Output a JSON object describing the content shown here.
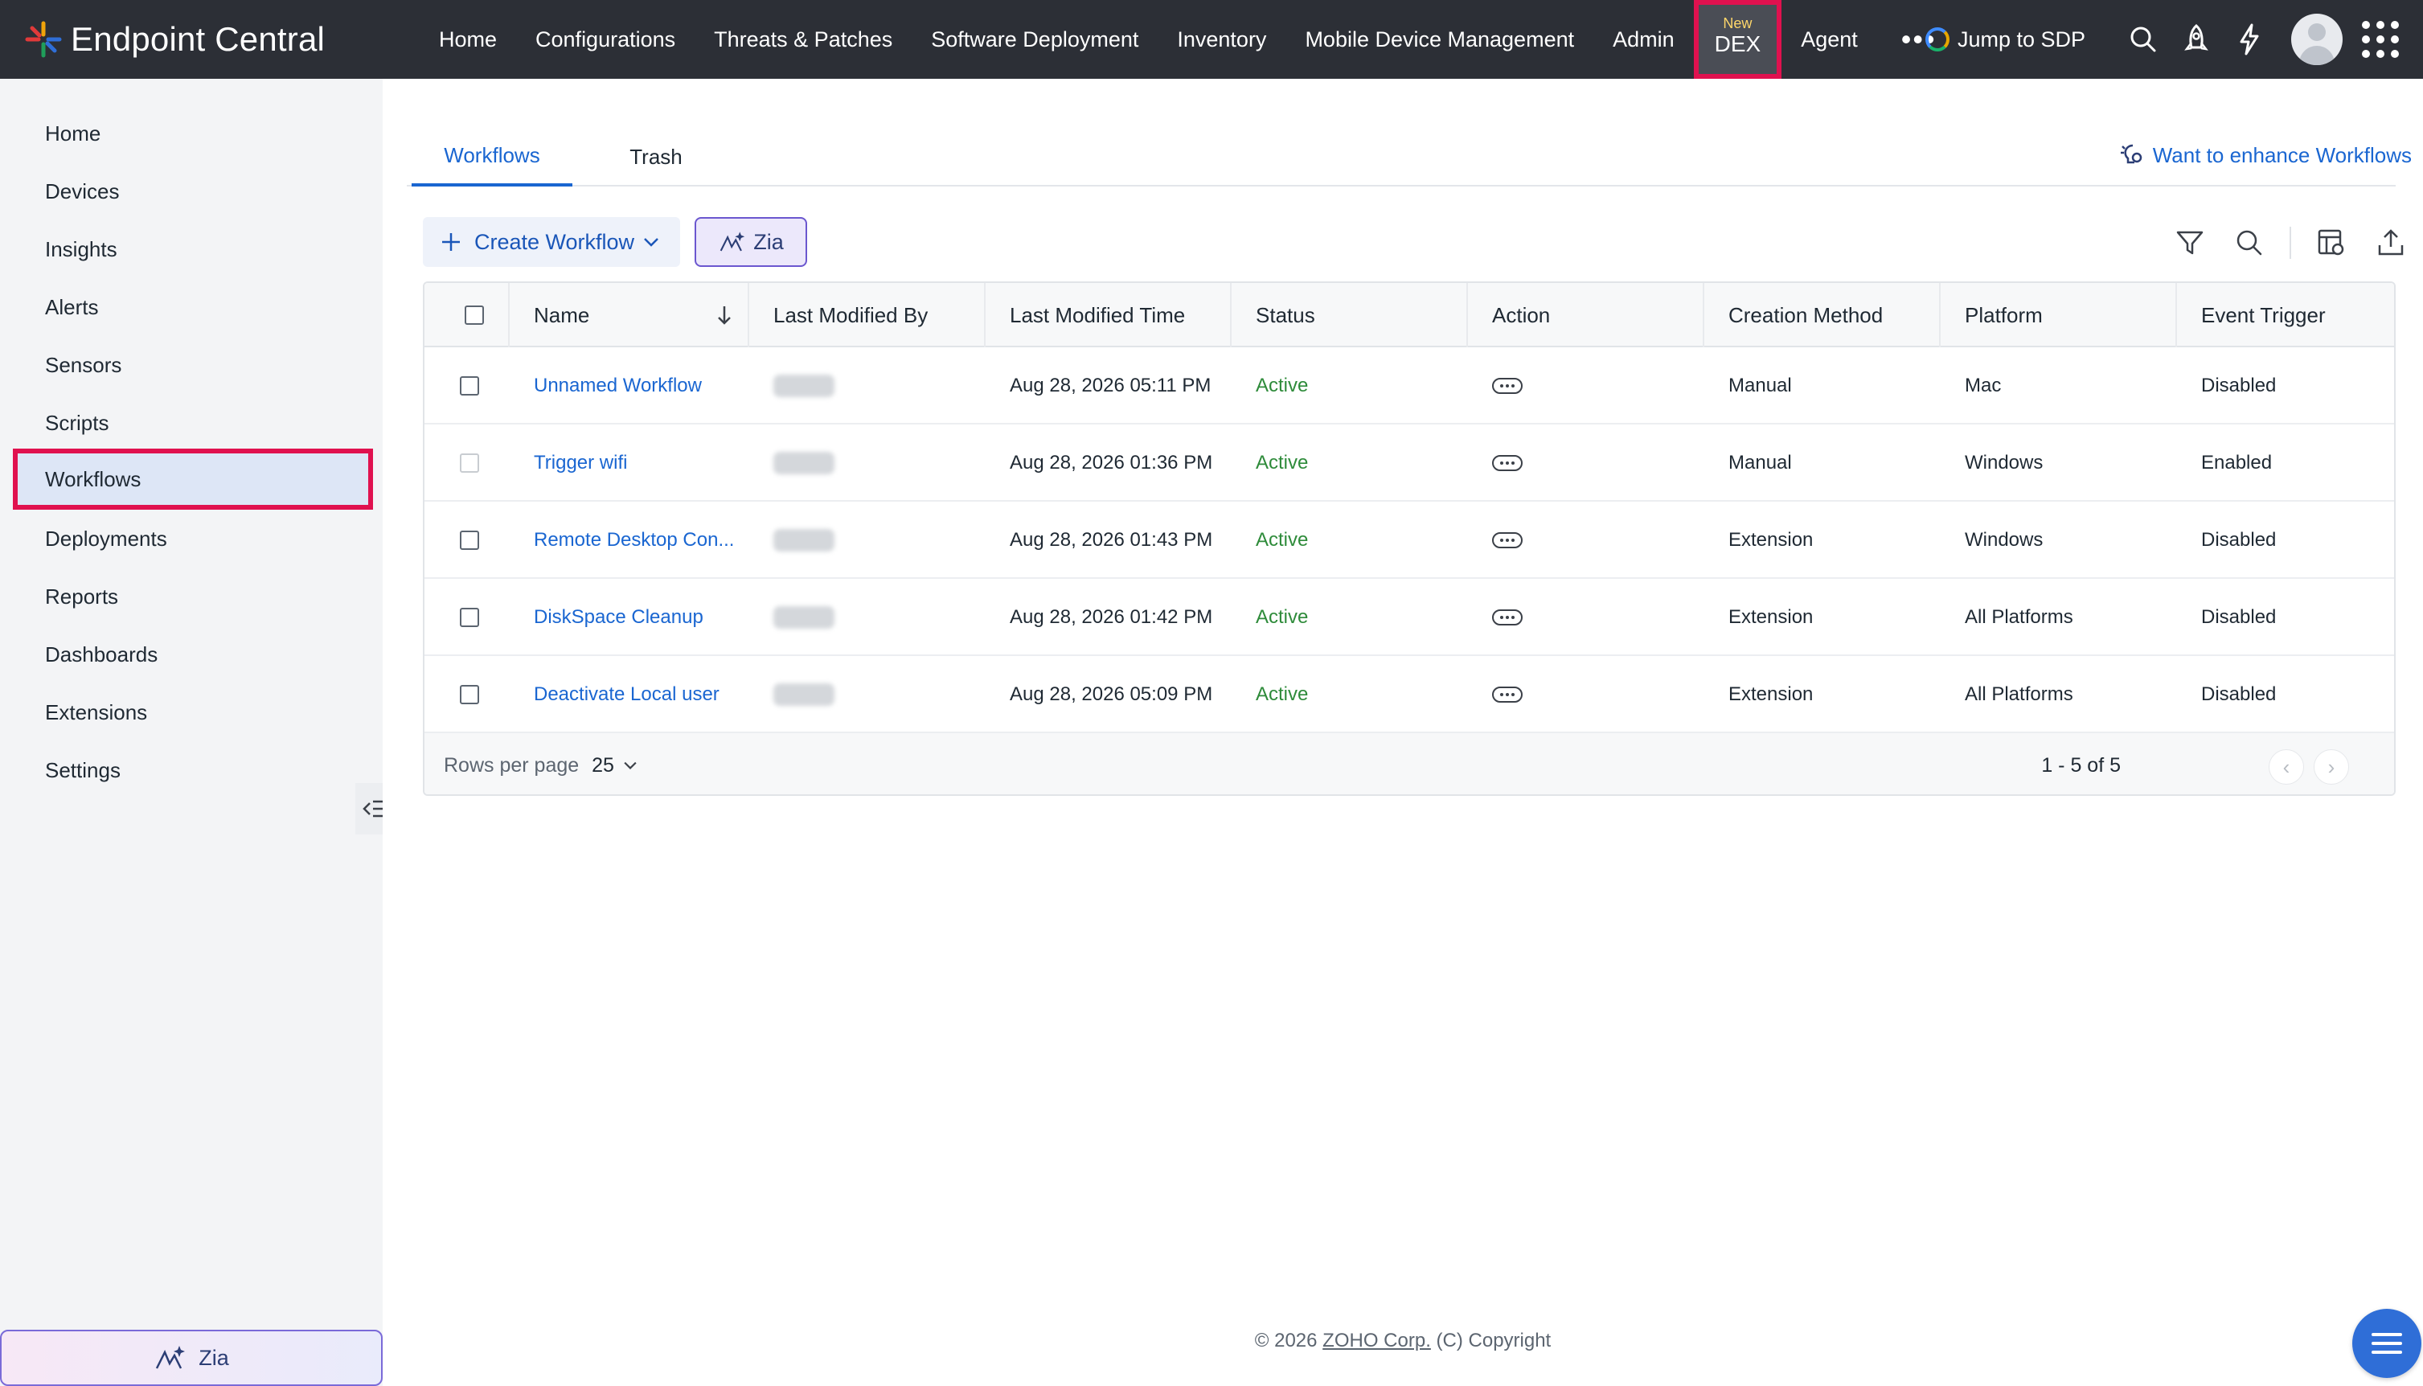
{
  "header": {
    "brand": "Endpoint Central",
    "nav": [
      {
        "label": "Home"
      },
      {
        "label": "Configurations"
      },
      {
        "label": "Threats & Patches"
      },
      {
        "label": "Software Deployment"
      },
      {
        "label": "Inventory"
      },
      {
        "label": "Mobile Device Management"
      },
      {
        "label": "Admin"
      },
      {
        "label": "DEX",
        "tag": "New"
      },
      {
        "label": "Agent"
      }
    ],
    "more": "•••",
    "jump_label": "Jump to SDP",
    "icons": [
      "search-icon",
      "rocket-icon",
      "lightning-icon",
      "avatar",
      "apps-grid-icon"
    ]
  },
  "sidebar": {
    "items": [
      {
        "label": "Home"
      },
      {
        "label": "Devices"
      },
      {
        "label": "Insights"
      },
      {
        "label": "Alerts"
      },
      {
        "label": "Sensors"
      },
      {
        "label": "Scripts"
      },
      {
        "label": "Workflows",
        "active": true
      },
      {
        "label": "Deployments"
      },
      {
        "label": "Reports"
      },
      {
        "label": "Dashboards"
      },
      {
        "label": "Extensions"
      },
      {
        "label": "Settings"
      }
    ],
    "zia_label": "Zia"
  },
  "main": {
    "tabs": [
      {
        "label": "Workflows",
        "active": true
      },
      {
        "label": "Trash"
      }
    ],
    "enhance_link": "Want to enhance Workflows",
    "create_label": "Create Workflow",
    "zia_label": "Zia",
    "table": {
      "columns": [
        "Name",
        "Last Modified By",
        "Last Modified Time",
        "Status",
        "Action",
        "Creation Method",
        "Platform",
        "Event Trigger"
      ],
      "rows": [
        {
          "name": "Unnamed Workflow",
          "time": "Aug 28, 2026 05:11 PM",
          "status": "Active",
          "method": "Manual",
          "platform": "Mac",
          "trigger": "Disabled"
        },
        {
          "name": "Trigger wifi",
          "time": "Aug 28, 2026 01:36 PM",
          "status": "Active",
          "method": "Manual",
          "platform": "Windows",
          "trigger": "Enabled"
        },
        {
          "name": "Remote Desktop Con...",
          "time": "Aug 28, 2026 01:43 PM",
          "status": "Active",
          "method": "Extension",
          "platform": "Windows",
          "trigger": "Disabled"
        },
        {
          "name": "DiskSpace Cleanup",
          "time": "Aug 28, 2026 01:42 PM",
          "status": "Active",
          "method": "Extension",
          "platform": "All Platforms",
          "trigger": "Disabled"
        },
        {
          "name": "Deactivate Local user",
          "time": "Aug 28, 2026 05:09 PM",
          "status": "Active",
          "method": "Extension",
          "platform": "All Platforms",
          "trigger": "Disabled"
        }
      ],
      "rows_per_page_label": "Rows per page",
      "rows_per_page": "25",
      "range": "1 - 5 of 5"
    },
    "footer": {
      "prefix": "© 2026 ",
      "company": "ZOHO Corp.",
      "suffix": " (C) Copyright"
    }
  },
  "colors": {
    "accent": "#1a66d1",
    "topbar": "#2c2f36",
    "highlight": "#e0114f",
    "active_status": "#2e8b3a"
  }
}
